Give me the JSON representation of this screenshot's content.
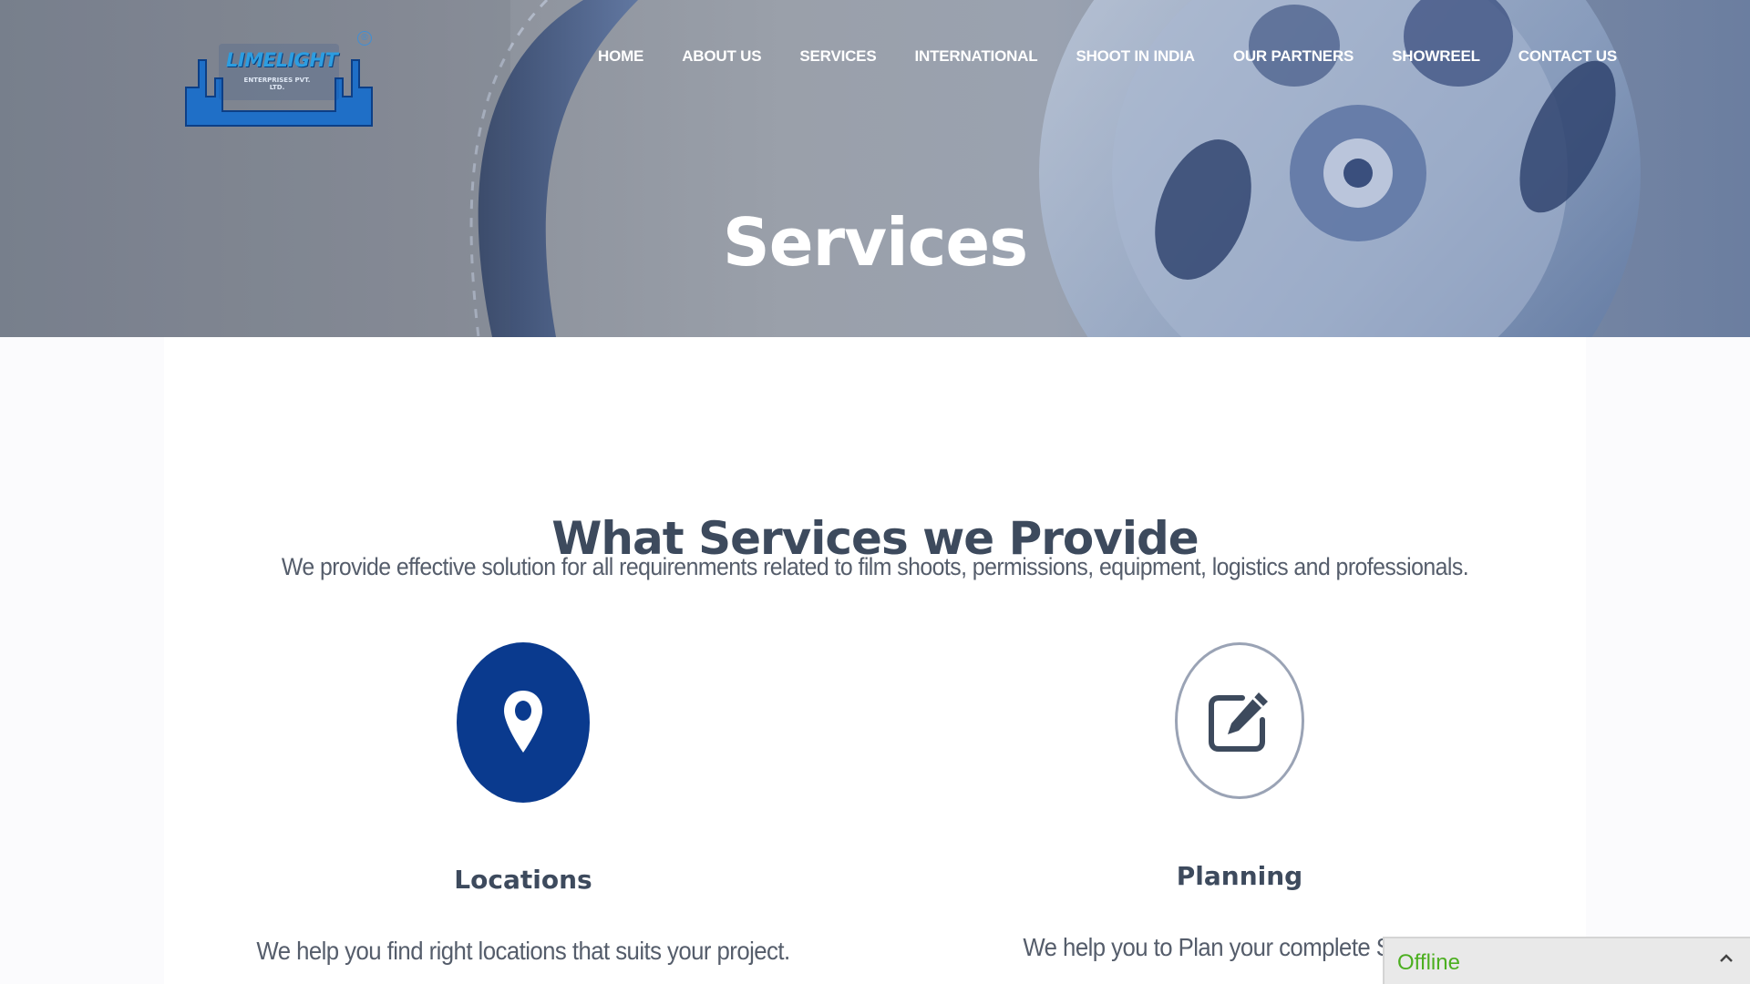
{
  "header": {
    "logo": {
      "text": "LIMELIGHT",
      "subtext": "ENTERPRISES PVT. LTD.",
      "registered_mark": "®"
    },
    "nav": [
      {
        "label": "HOME"
      },
      {
        "label": "ABOUT US"
      },
      {
        "label": "SERVICES"
      },
      {
        "label": "INTERNATIONAL"
      },
      {
        "label": "SHOOT IN INDIA"
      },
      {
        "label": "OUR PARTNERS"
      },
      {
        "label": "SHOWREEL"
      },
      {
        "label": "CONTACT US"
      }
    ],
    "page_title": "Services"
  },
  "main": {
    "heading": "What Services we Provide",
    "subheading": "We provide effective solution for all requirenments related to film shoots, permissions, equipment, logistics and professionals.",
    "services": [
      {
        "title": "Locations",
        "text": "We help you find right locations that suits your project.",
        "icon": "map-pin-icon"
      },
      {
        "title": "Planning",
        "text": "We help you to Plan your complete Shoot P",
        "icon": "edit-icon"
      }
    ]
  },
  "chat_widget": {
    "status": "Offline",
    "status_color": "#4caf20",
    "toggle_icon": "chevron-up-icon"
  },
  "colors": {
    "brand_blue": "#0a3a8e",
    "heading_text": "#3d4a5d"
  }
}
